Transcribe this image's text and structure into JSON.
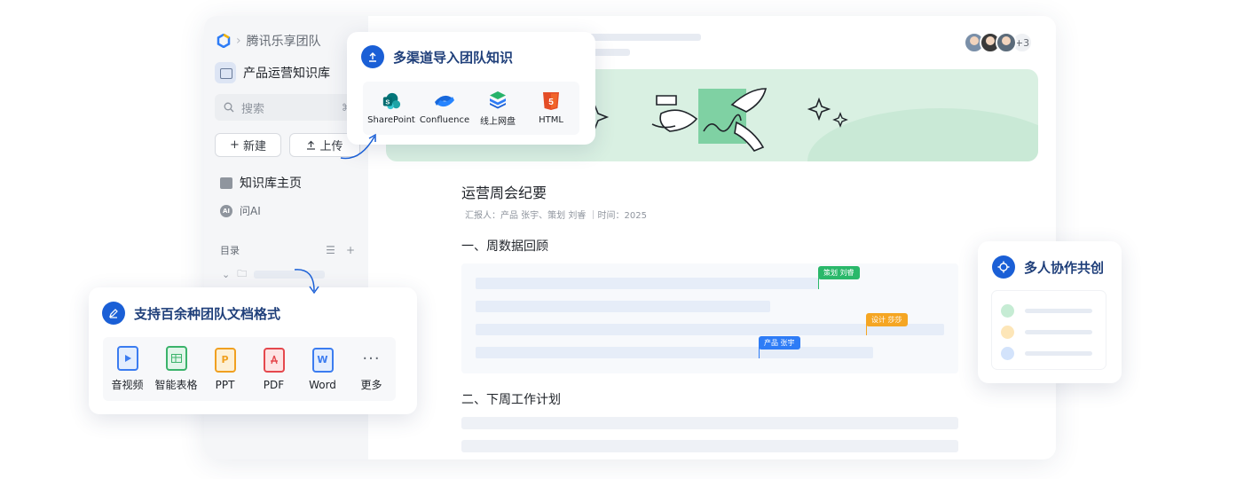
{
  "breadcrumb": {
    "team": "腾讯乐享团队"
  },
  "sidebar": {
    "kb_title": "产品运营知识库",
    "search": {
      "placeholder": "搜索",
      "shortcut": "⌘"
    },
    "new_label": "新建",
    "upload_label": "上传",
    "nav": [
      {
        "label": "知识库主页",
        "icon": "home-icon"
      },
      {
        "label": "问AI",
        "icon": "ai-icon"
      }
    ],
    "toc_label": "目录"
  },
  "doc": {
    "title": "运营周会纪要",
    "meta": "汇报人：产品 张宇、策划 刘睿 ｜时间：2025",
    "section1": "一、周数据回顾",
    "section2": "二、下周工作计划",
    "tags": [
      {
        "label": "策划 刘睿",
        "color": "#2ab86a"
      },
      {
        "label": "设计 莎莎",
        "color": "#f5a623"
      },
      {
        "label": "产品 张宇",
        "color": "#2e7cf6"
      }
    ]
  },
  "collaborators": {
    "more": "+3"
  },
  "import_card": {
    "title": "多渠道导入团队知识",
    "channels": [
      {
        "label": "SharePoint",
        "icon": "sharepoint-icon"
      },
      {
        "label": "Confluence",
        "icon": "confluence-icon"
      },
      {
        "label": "线上网盘",
        "icon": "cloud-drive-icon"
      },
      {
        "label": "HTML",
        "icon": "html5-icon"
      }
    ]
  },
  "formats_card": {
    "title": "支持百余种团队文档格式",
    "formats": [
      {
        "label": "音视频",
        "icon": "video-file-icon",
        "color": "#3b7cf0"
      },
      {
        "label": "智能表格",
        "icon": "sheet-file-icon",
        "color": "#3bb36b"
      },
      {
        "label": "PPT",
        "icon": "ppt-file-icon",
        "color": "#f0a020"
      },
      {
        "label": "PDF",
        "icon": "pdf-file-icon",
        "color": "#e5484d"
      },
      {
        "label": "Word",
        "icon": "word-file-icon",
        "color": "#3b7cf0"
      },
      {
        "label": "更多",
        "icon": "more-icon"
      }
    ]
  },
  "collab_card": {
    "title": "多人协作共创",
    "dot_colors": [
      "#c6ecd4",
      "#fde6b8",
      "#d3e3fb"
    ]
  },
  "colors": {
    "accent": "#1a5fd6",
    "banner": "#d9f0e2"
  }
}
